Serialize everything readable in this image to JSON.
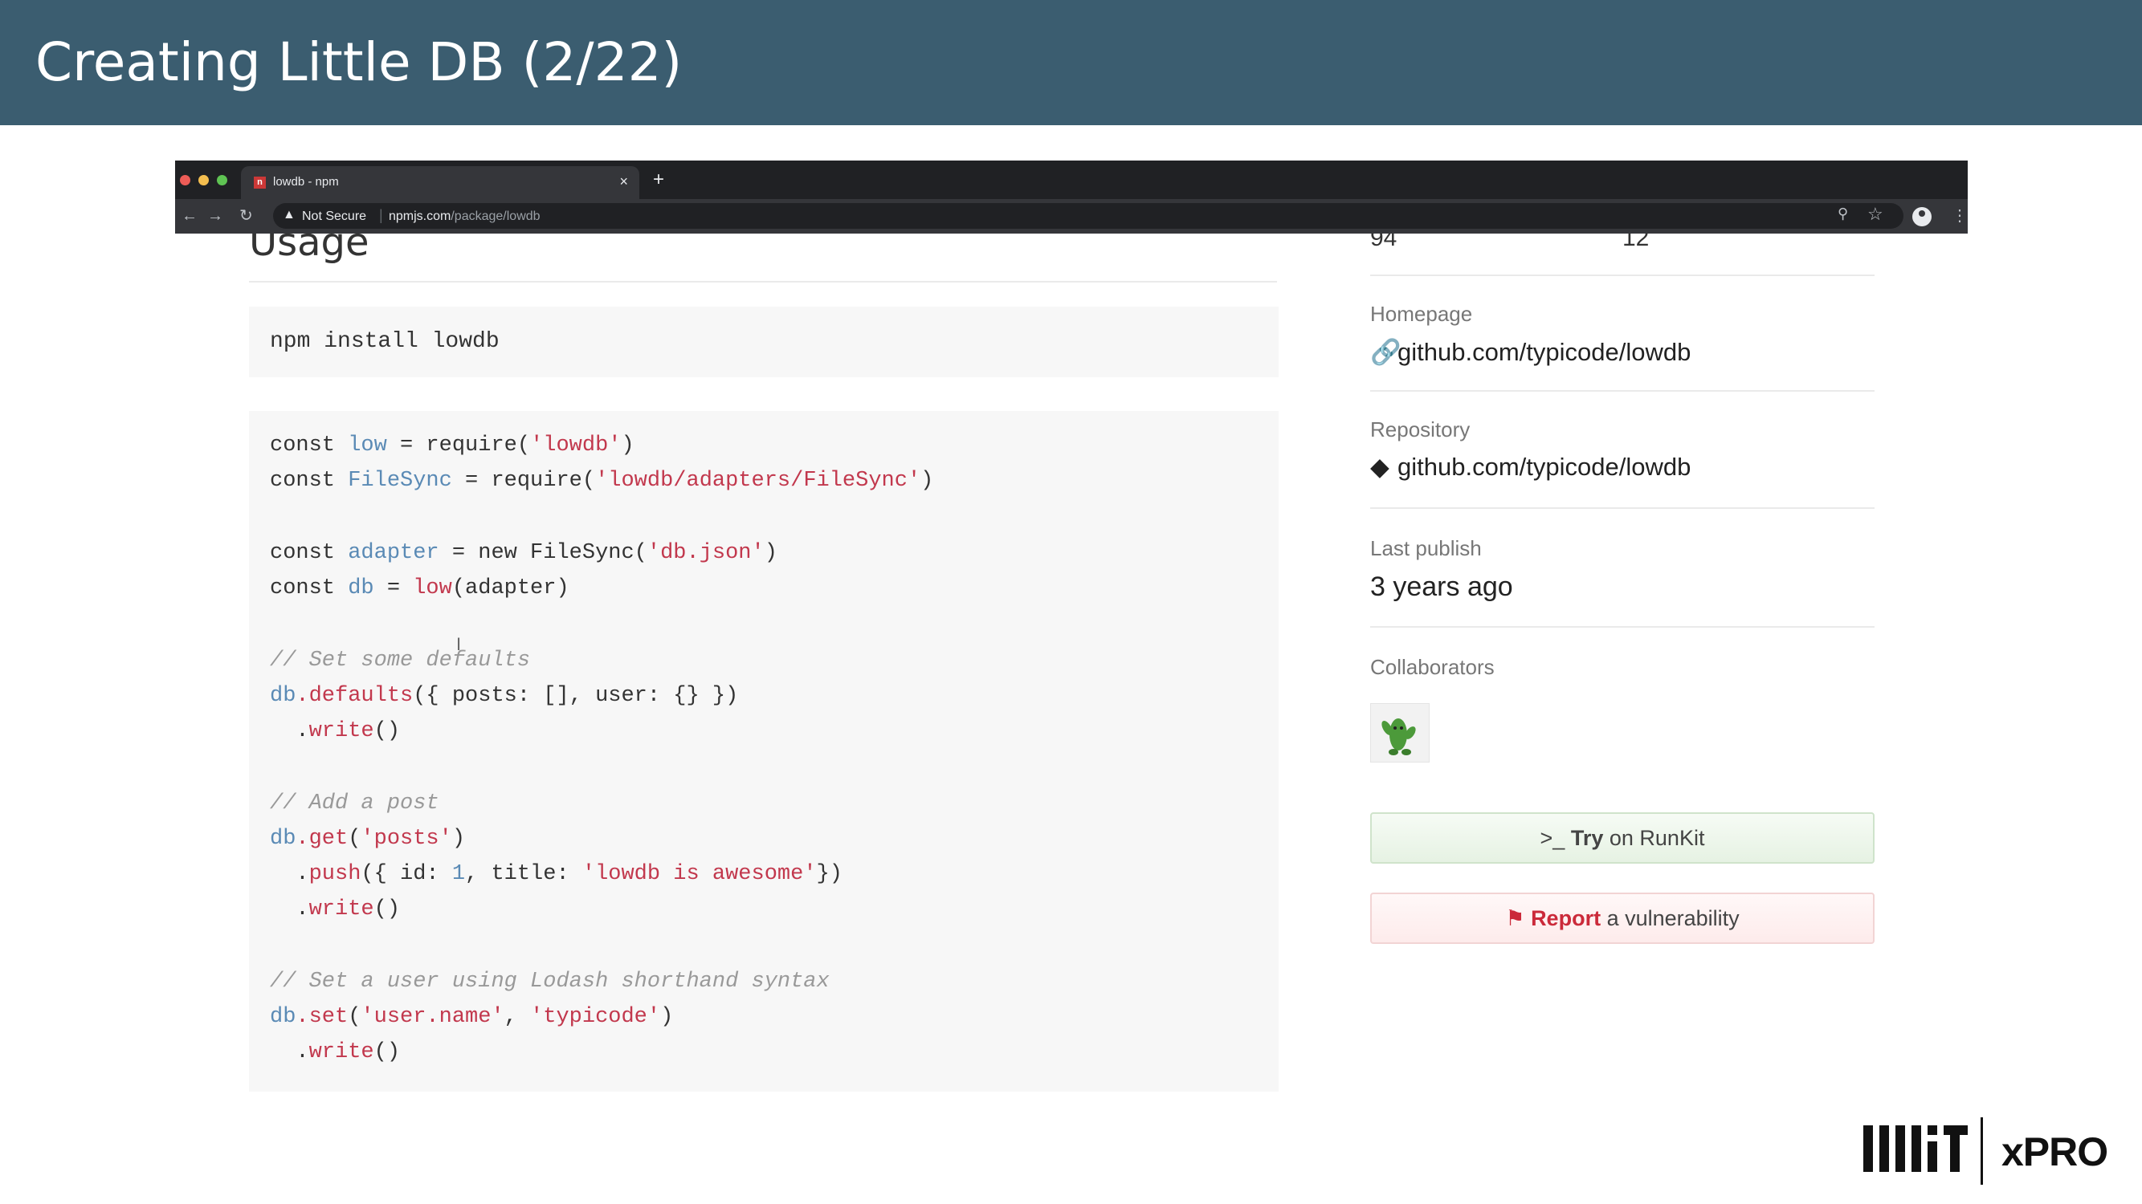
{
  "slide": {
    "title": "Creating Little DB (2/22)"
  },
  "browser": {
    "tab_title": "lowdb - npm",
    "tab_close": "×",
    "new_tab": "+",
    "security": "Not Secure",
    "url_host": "npmjs.com",
    "url_path": "/package/lowdb",
    "icons": [
      "back-icon",
      "forward-icon",
      "reload-icon",
      "warning-icon",
      "zoom-icon",
      "star-icon",
      "profile-icon",
      "menu-icon"
    ]
  },
  "main": {
    "heading": "Usage",
    "install_cmd": "npm install lowdb",
    "code": {
      "l1": {
        "kw": "const ",
        "var": "low",
        "op": " = require(",
        "str": "'lowdb'",
        "end": ")"
      },
      "l2": {
        "kw": "const ",
        "var": "FileSync",
        "op": " = require(",
        "str": "'lowdb/adapters/FileSync'",
        "end": ")"
      },
      "l3": {
        "kw": "const ",
        "var": "adapter",
        "op": " = new FileSync(",
        "str": "'db.json'",
        "end": ")"
      },
      "l4": {
        "kw": "const ",
        "var": "db",
        "op": " = ",
        "fn": "low",
        "end": "(adapter)"
      },
      "c1": "// Set some defaults",
      "l5": {
        "var": "db",
        "fn": ".defaults",
        "end": "({ posts: [], user: {} })"
      },
      "l6": {
        "pre": "  .",
        "fn": "write",
        "end": "()"
      },
      "c2": "// Add a post",
      "l7": {
        "var": "db",
        "fn": ".get",
        "op": "(",
        "str": "'posts'",
        "end": ")"
      },
      "l8": {
        "pre": "  .",
        "fn": "push",
        "op": "({ id: ",
        "num": "1",
        "mid": ", title: ",
        "str": "'lowdb is awesome'",
        "end": "})"
      },
      "l9": {
        "pre": "  .",
        "fn": "write",
        "end": "()"
      },
      "c3": "// Set a user using Lodash shorthand syntax",
      "l10": {
        "var": "db",
        "fn": ".set",
        "op": "(",
        "str": "'user.name'",
        "mid": ", ",
        "str2": "'typicode'",
        "end": ")"
      },
      "l11": {
        "pre": "  .",
        "fn": "write",
        "end": "()"
      }
    }
  },
  "sidebar": {
    "stats": [
      "94",
      "12"
    ],
    "homepage": {
      "label": "Homepage",
      "link": "github.com/typicode/lowdb"
    },
    "repository": {
      "label": "Repository",
      "link": "github.com/typicode/lowdb"
    },
    "last_publish": {
      "label": "Last publish",
      "value": "3 years ago"
    },
    "collaborators": {
      "label": "Collaborators"
    },
    "runkit": {
      "strong": "Try",
      "rest": " on RunKit",
      "prefix": ">_"
    },
    "vuln": {
      "strong": "Report",
      "rest": " a vulnerability"
    }
  },
  "logo": {
    "brand": "xPRO"
  },
  "colors": {
    "header": "#3b5d70",
    "string": "#c2384d",
    "variable": "#5a8ab5",
    "comment": "#999999",
    "vuln": "#cb2a3a"
  }
}
